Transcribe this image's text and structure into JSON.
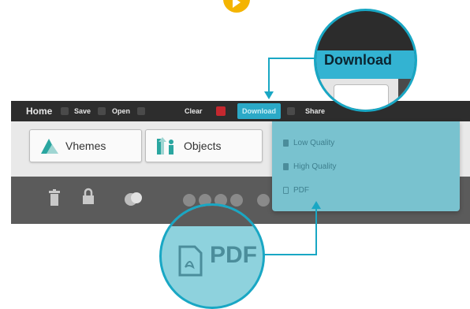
{
  "menubar": {
    "items": [
      {
        "label": "Home"
      },
      {
        "label": "Save"
      },
      {
        "label": "Open"
      },
      {
        "label": "Clear"
      },
      {
        "label": "Download"
      },
      {
        "label": "Share"
      }
    ]
  },
  "toolbar": {
    "vhemes_label": "Vhemes",
    "objects_label": "Objects"
  },
  "dropdown": {
    "items": [
      {
        "label": "Low Quality"
      },
      {
        "label": "High Quality"
      },
      {
        "label": "PDF"
      }
    ]
  },
  "callouts": {
    "download_label": "Download",
    "pdf_label": "PDF"
  },
  "colors": {
    "accent": "#19a7c4",
    "menubar_bg": "#2d2d2d",
    "dropdown_bg": "#79c2cf"
  }
}
